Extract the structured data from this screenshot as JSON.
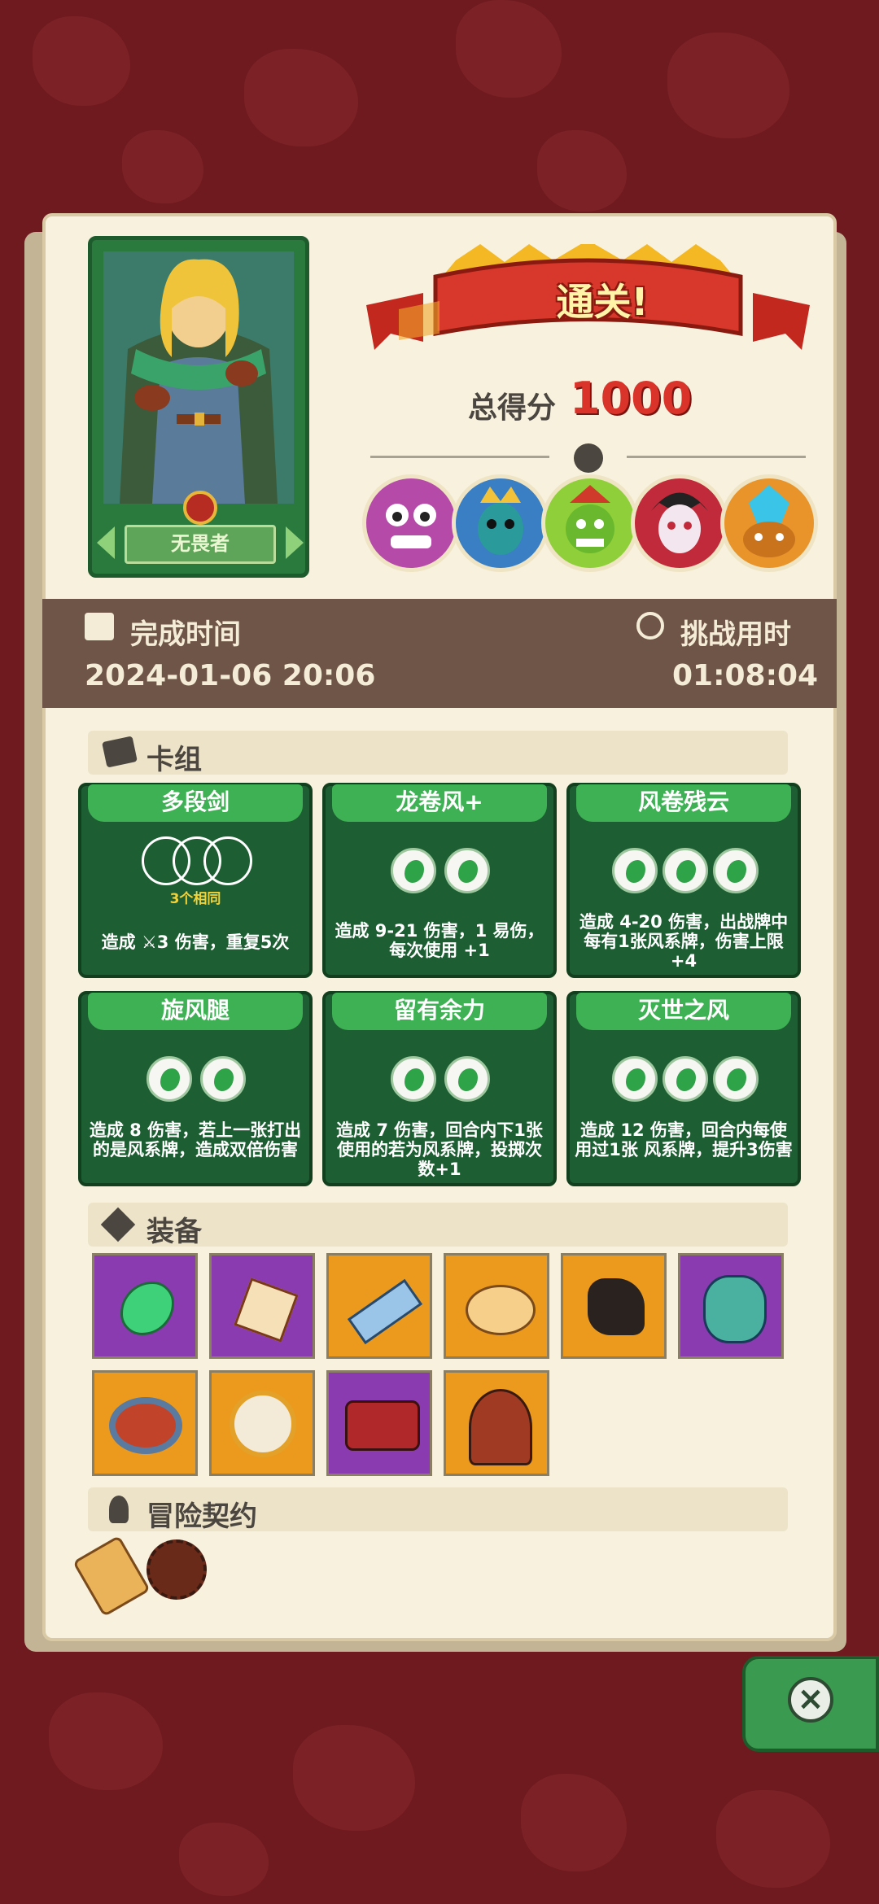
{
  "hero": {
    "name": "无畏者"
  },
  "result": {
    "banner": "通关!",
    "score_label": "总得分",
    "score": "1000"
  },
  "times": {
    "finish_label": "完成时间",
    "finish_value": "2024-01-06 20:06",
    "duration_label": "挑战用时",
    "duration_value": "01:08:04"
  },
  "deck": {
    "title": "卡组",
    "cards": [
      {
        "title": "多段剑",
        "badge": "3个相同",
        "text": "造成 ⚔3 伤害，重复5次"
      },
      {
        "title": "龙卷风+",
        "text": "造成 9-21 伤害，1 易伤，每次使用 +1"
      },
      {
        "title": "风卷残云",
        "text": "造成 4-20 伤害，出战牌中每有1张风系牌，伤害上限+4"
      },
      {
        "title": "旋风腿",
        "text": "造成 8 伤害，若上一张打出的是风系牌，造成双倍伤害"
      },
      {
        "title": "留有余力",
        "text": "造成 7 伤害，回合内下1张使用的若为风系牌，投掷次数+1"
      },
      {
        "title": "灭世之风",
        "text": "造成 12 伤害，回合内每使用过1张 风系牌，提升3伤害"
      }
    ]
  },
  "equipment": {
    "title": "装备",
    "items": [
      {
        "icon": "green-wind-gem-icon",
        "rarity": "purple"
      },
      {
        "icon": "spiked-dice-icon",
        "rarity": "purple"
      },
      {
        "icon": "blue-saw-blade-icon",
        "rarity": "orange"
      },
      {
        "icon": "blue-paint-palette-icon",
        "rarity": "orange"
      },
      {
        "icon": "dark-boot-icon",
        "rarity": "orange"
      },
      {
        "icon": "demon-mask-icon",
        "rarity": "purple"
      },
      {
        "icon": "stone-ring-icon",
        "rarity": "orange"
      },
      {
        "icon": "golden-shield-icon",
        "rarity": "orange"
      },
      {
        "icon": "red-bracelet-icon",
        "rarity": "purple"
      },
      {
        "icon": "red-hood-icon",
        "rarity": "orange"
      }
    ]
  },
  "contract": {
    "title": "冒险契约",
    "items": [
      "scroll-icon",
      "pipe-icon"
    ]
  }
}
